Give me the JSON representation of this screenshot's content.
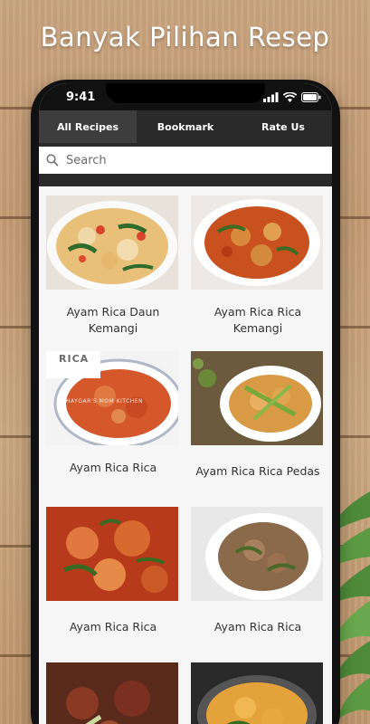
{
  "promo": {
    "title": "Banyak Pilihan Resep"
  },
  "status_bar": {
    "time": "9:41"
  },
  "tabs": [
    {
      "label": "All Recipes",
      "active": true
    },
    {
      "label": "Bookmark",
      "active": false
    },
    {
      "label": "Rate Us",
      "active": false
    }
  ],
  "search": {
    "placeholder": "Search"
  },
  "recipes": [
    {
      "title": "Ayam Rica Daun Kemangi"
    },
    {
      "title": "Ayam Rica Rica Kemangi"
    },
    {
      "title": "Ayam Rica Rica",
      "image_text": "RICA",
      "watermark": "HAYGAR'S MOM KITCHEN"
    },
    {
      "title": "Ayam Rica Rica Pedas"
    },
    {
      "title": "Ayam Rica Rica"
    },
    {
      "title": "Ayam Rica Rica"
    },
    {
      "title": ""
    },
    {
      "title": ""
    }
  ],
  "colors": {
    "phone_frame": "#111111",
    "tab_bar": "#2a2a2a",
    "active_tab": "#3d3d3d",
    "wood": "#c9a47f"
  }
}
